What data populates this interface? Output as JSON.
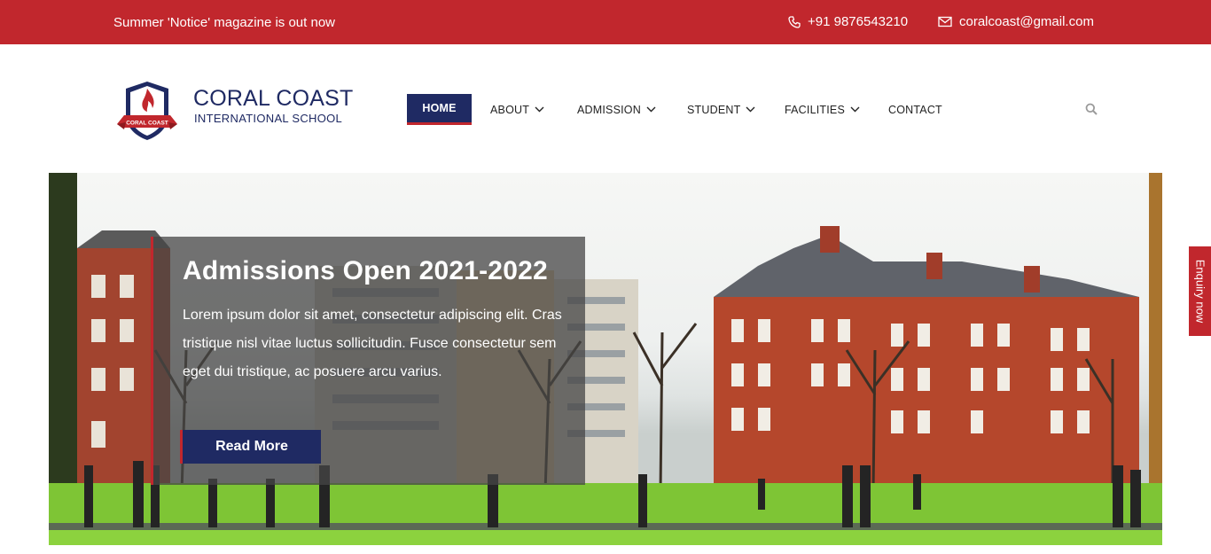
{
  "topbar": {
    "notice": "Summer 'Notice' magazine is out now",
    "phone": "+91 9876543210",
    "email": "coralcoast@gmail.com",
    "background": "#c1272d"
  },
  "brand": {
    "name": "CORAL COAST",
    "subtitle": "INTERNATIONAL SCHOOL",
    "badge_text": "CORAL COAST",
    "primary_color": "#1f2a63",
    "accent_color": "#c1272d"
  },
  "nav": {
    "items": [
      {
        "label": "HOME",
        "active": true
      },
      {
        "label": "ABOUT"
      },
      {
        "label": "ADMISSION"
      },
      {
        "label": "STUDENT"
      },
      {
        "label": "FACILITIES"
      },
      {
        "label": "CONTACT"
      }
    ],
    "search_icon": "search-icon"
  },
  "hero": {
    "title": "Admissions Open 2021-2022",
    "text": "Lorem ipsum dolor sit amet, consectetur adipiscing elit. Cras tristique nisl vitae luctus sollicitudin. Fusce consectetur sem eget dui tristique, ac posuere arcu varius.",
    "button": "Read More"
  },
  "enquiry": {
    "label": "Enquiry now"
  }
}
